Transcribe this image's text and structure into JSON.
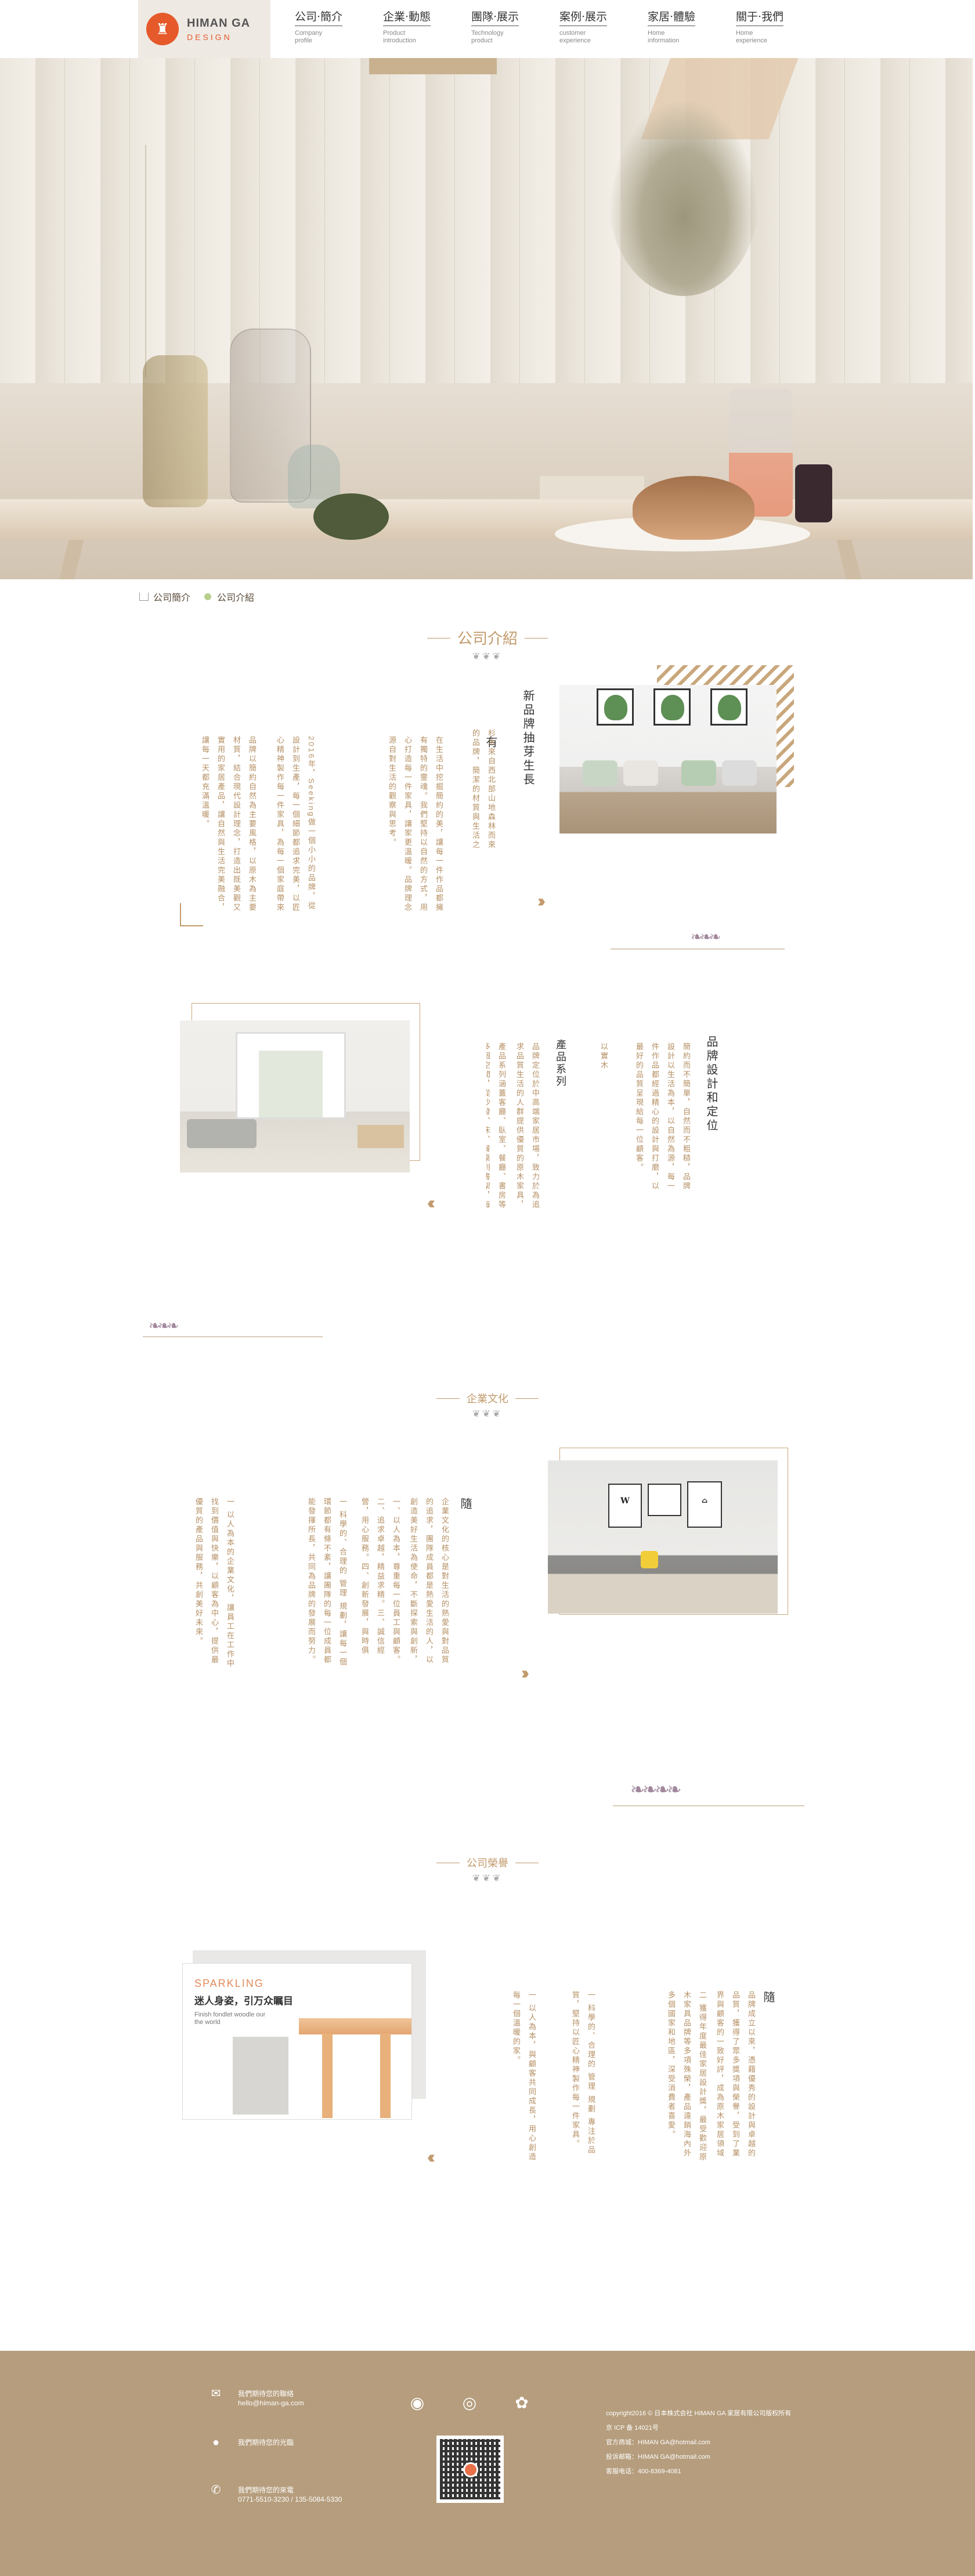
{
  "brand": {
    "name": "HIMAN GA",
    "sub": "DESIGN",
    "accent": "#e5592b"
  },
  "nav": [
    {
      "cn": "公司·簡介",
      "en": "Company profile"
    },
    {
      "cn": "企業·動態",
      "en": "Product introduction"
    },
    {
      "cn": "團隊·展示",
      "en": "Technology product"
    },
    {
      "cn": "案例·展示",
      "en": "customer experience"
    },
    {
      "cn": "家居·體驗",
      "en": "Home information"
    },
    {
      "cn": "關于·我們",
      "en": "Home experience"
    }
  ],
  "breadcrumb": {
    "home": "公司簡介",
    "current": "公司介紹"
  },
  "section1": {
    "title": "公司介紹",
    "heading": "新品牌抽芽生長",
    "heading2": "有",
    "col1": "杉木來自西北部山地森林而來的品牌，簡潔的材質與生活之間的質感，追求自然，帶着對自然的熱愛與尊重，以原木家具的溫度讓生活更美好。",
    "col2": "在生活中挖掘簡約的美，讓每一件作品都擁有獨特的靈魂。我們堅持以自然的方式，用心打造每一件家具，讓家更溫暖。品牌理念源自對生活的觀察與思考。",
    "col3": "2016年，Seeking做一個小小的品牌，從設計到生產，每一個細節都追求完美，以匠心精神製作每一件家具，為每一個家庭帶來舒適與美好的生活體驗。",
    "col4": "品牌以簡約自然為主要風格，以原木為主要材質，結合現代設計理念，打造出既美觀又實用的家居產品，讓自然與生活完美融合，讓每一天都充滿溫暖。"
  },
  "section2": {
    "heading": "品牌設計和定位",
    "sub": "產品系列",
    "col1": "簡約而不簡單，自然而不粗糙，品牌設計以生活為本，以自然為源，每一件作品都經過精心的設計與打磨，以最好的品質呈現給每一位顧客。",
    "col2": "品牌定位於中高端家居市場，致力於為追求品質生活的人群提供優質的原木家具，設計風格簡約自然，充滿北歐風情與東方韻味的融合之美。",
    "col3": "產品系列涵蓋客廳、臥室、餐廳、書房等多個空間，從沙發、床、餐桌到書架，每一件都是匠心之作，為家帶來自然與溫馨的氛圍。",
    "col4": "以實木為主要材料，保留木材天然的紋理與質感，讓每一件家具都獨一無二。"
  },
  "section3": {
    "title": "企業文化",
    "heading": "隨",
    "col1": "企業文化的核心是對生活的熱愛與對品質的追求，團隊成員都是熱愛生活的人，以創造美好生活為使命，不斷探索與創新，為顧客帶來更好的產品。",
    "col2": "一、以人為本，尊重每一位員工與顧客。二、追求卓越，精益求精。三、誠信經營，用心服務。四、創新發展，與時俱進，不斷突破自我。",
    "col3": "一 科學的、合理的 管理 規劃，讓每一個環節都有條不紊，讓團隊的每一位成員都能發揮所長，共同為品牌的發展而努力。",
    "col4": "一 以人為本的企業文化，讓員工在工作中找到價值與快樂，以顧客為中心，提供最優質的產品與服務，共創美好未來。"
  },
  "section4": {
    "title": "公司榮譽",
    "ad_title": "SPARKLING",
    "ad_line": "迷人身姿，引万众瞩目",
    "ad_en": "Finish fondlet woodle our the world",
    "heading": "隨",
    "col1": "品牌成立以來，憑藉優秀的設計與卓越的品質，獲得了眾多獎項與榮譽，受到了業界與顧客的一致好評，成為原木家居領域的知名品牌。",
    "col2": "二 獲得年度最佳家居設計獎，最受歡迎原木家具品牌等多項殊榮，產品遠銷海內外多個國家和地區，深受消費者喜愛。",
    "col3": "一 科學的、合理的 管理 規劃 專注於品質，堅持以匠心精神製作每一件家具。",
    "col4": "一 以人為本，與顧客共同成長，用心創造每一個溫暖的家。"
  },
  "footer": {
    "email_label": "我們期待您的聯絡",
    "email": "hello@himan-ga.com",
    "address_label": "我們期待您的光臨",
    "phone_label": "我們期待您的來電",
    "phone": "0771-5510-3230 / 135-5084-5330",
    "copyright": "copyright2016 © 日本株式会社 HIMAN GA 家居有限公司版权所有",
    "icp": "京 ICP 备 14021号",
    "site": "官方商城：HIMAN GA@hotmail.com",
    "mail": "投诉邮箱：HIMAN GA@hotmail.com",
    "hotline": "客服电话：400-8369-4081"
  }
}
